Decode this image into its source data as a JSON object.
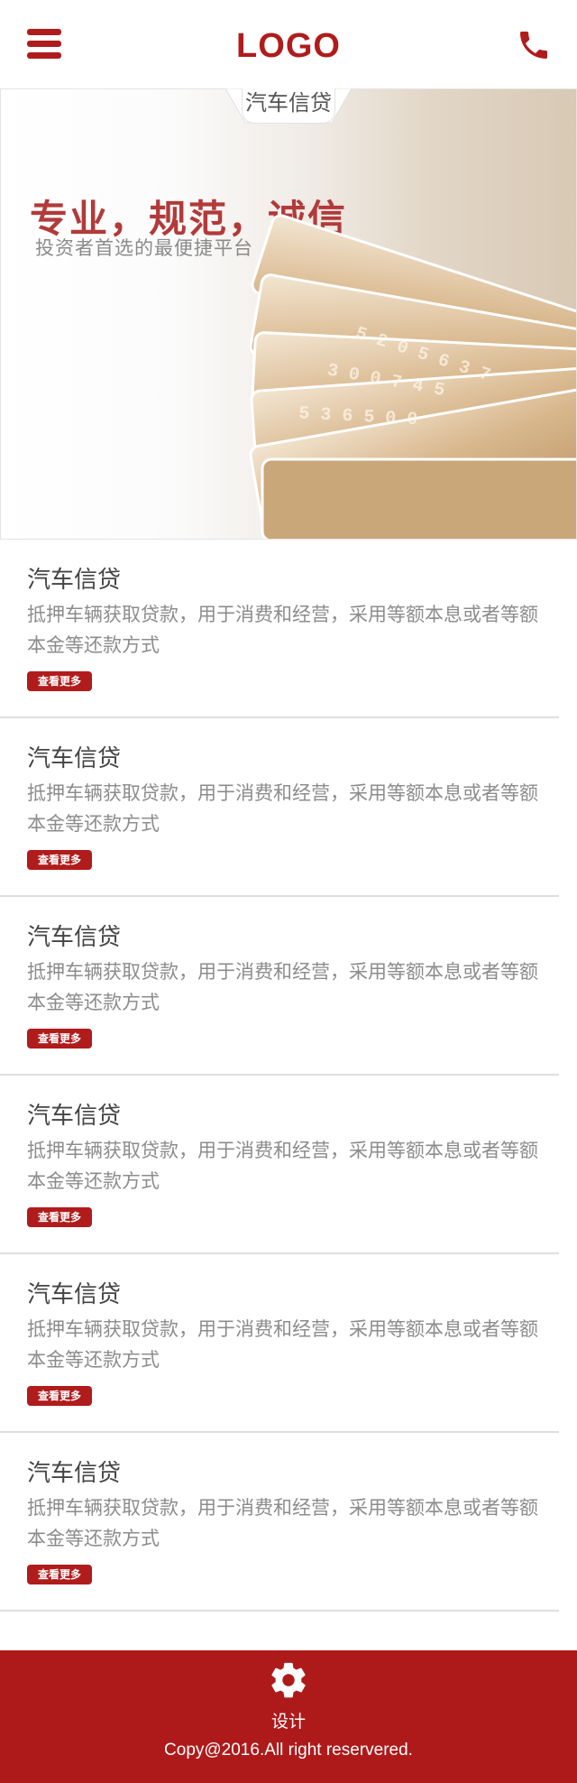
{
  "header": {
    "logo_text": "LOGO",
    "menu_icon": "hamburger-menu-icon",
    "phone_icon": "phone-icon",
    "brand_color": "#b01c1c"
  },
  "section": {
    "tab_label": "汽车信贷"
  },
  "banner": {
    "title": "专业，规范，诚信",
    "subtitle": "投资者首选的最便捷平台"
  },
  "items": [
    {
      "title": "汽车信贷",
      "desc": "抵押车辆获取贷款，用于消费和经营，采用等额本息或者等额本金等还款方式",
      "button": "查看更多"
    },
    {
      "title": "汽车信贷",
      "desc": "抵押车辆获取贷款，用于消费和经营，采用等额本息或者等额本金等还款方式",
      "button": "查看更多"
    },
    {
      "title": "汽车信贷",
      "desc": "抵押车辆获取贷款，用于消费和经营，采用等额本息或者等额本金等还款方式",
      "button": "查看更多"
    },
    {
      "title": "汽车信贷",
      "desc": "抵押车辆获取贷款，用于消费和经营，采用等额本息或者等额本金等还款方式",
      "button": "查看更多"
    },
    {
      "title": "汽车信贷",
      "desc": "抵押车辆获取贷款，用于消费和经营，采用等额本息或者等额本金等还款方式",
      "button": "查看更多"
    },
    {
      "title": "汽车信贷",
      "desc": "抵押车辆获取贷款，用于消费和经营，采用等额本息或者等额本金等还款方式",
      "button": "查看更多"
    }
  ],
  "footer": {
    "icon": "gear-icon",
    "label": "设计",
    "copyright": "Copy@2016.All right reservered.",
    "background_color": "#ae1a1a"
  }
}
